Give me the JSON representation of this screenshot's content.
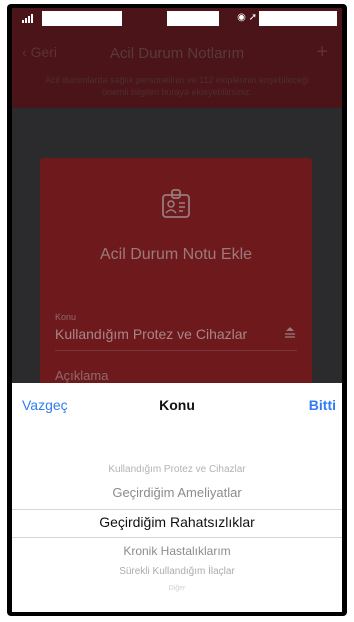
{
  "navbar": {
    "back_label": "Geri",
    "title": "Acil Durum Notlarım",
    "add_glyph": "+"
  },
  "notice": "Acil durumlarda sağlık personelinin ve 112 ekiplerinin erişebileceği önemli bilgileri buraya ekleyebilirsiniz.",
  "card": {
    "title": "Acil Durum Notu Ekle",
    "field_label": "Konu",
    "field_value": "Kullandığım Protez ve Cihazlar",
    "description_label": "Açıklama"
  },
  "picker": {
    "cancel_label": "Vazgeç",
    "title": "Konu",
    "done_label": "Bitti",
    "options": [
      "Kullandığım Protez ve Cihazlar",
      "Geçirdiğim Ameliyatlar",
      "Geçirdiğim Rahatsızlıklar",
      "Kronik Hastalıklarım",
      "Sürekli Kullandığım İlaçlar",
      "Diğer"
    ],
    "selected_index": 2
  },
  "colors": {
    "accent": "#2f7bf5",
    "card": "#6e1a1d",
    "header": "#4a1418"
  }
}
